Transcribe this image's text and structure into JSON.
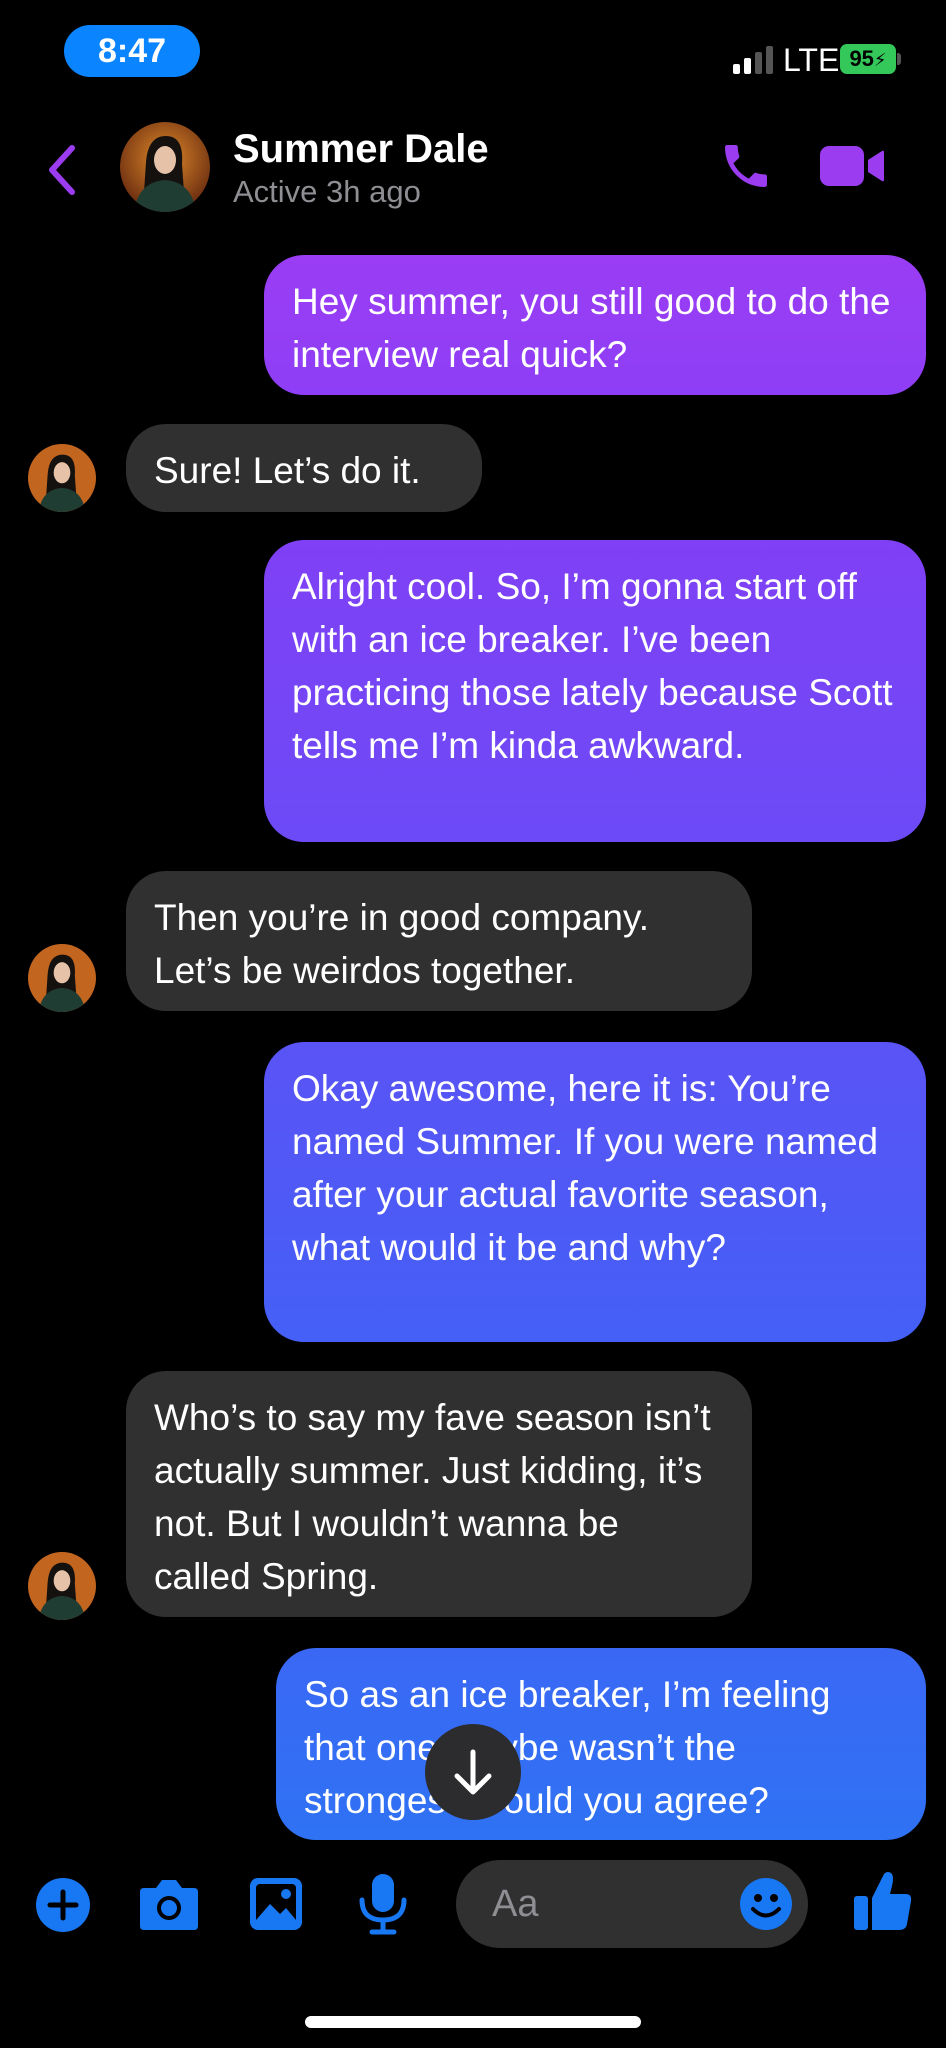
{
  "status_bar": {
    "time": "8:47",
    "network": "LTE",
    "battery": "95"
  },
  "header": {
    "name": "Summer Dale",
    "status": "Active 3h ago"
  },
  "messages": [
    {
      "from": "me",
      "text": "Hey summer, you still good to do the interview real quick?"
    },
    {
      "from": "them",
      "text": "Sure! Let’s do it."
    },
    {
      "from": "me",
      "text": "Alright cool. So, I’m gonna start off with an ice breaker. I’ve been practicing those lately because Scott tells me I’m kinda awkward."
    },
    {
      "from": "them",
      "text": "Then you’re in good company. Let’s be weirdos together."
    },
    {
      "from": "me",
      "text": "Okay awesome, here it is: You’re named Summer. If you were named after your actual favorite season, what would it be and why?"
    },
    {
      "from": "them",
      "text": "Who’s to say my fave season isn’t actually summer. Just kidding, it’s not. But I wouldn’t wanna be called Spring."
    },
    {
      "from": "me",
      "text": "So as an ice breaker, I’m feeling that one maybe wasn’t the strongest, would you agree?"
    }
  ],
  "composer": {
    "placeholder": "Aa"
  },
  "colors": {
    "accent_purple": "#9b3cf0",
    "bubble_purple": "#8e3cf5",
    "bubble_violet": "#6a4cf6",
    "bubble_blue": "#3b66f5",
    "bubble_gray": "#303030",
    "composer_blue": "#1877f2"
  },
  "icons": [
    "back-chevron-icon",
    "phone-icon",
    "video-camera-icon",
    "chevron-down-arrow-icon",
    "plus-icon",
    "camera-icon",
    "image-icon",
    "microphone-icon",
    "emoji-icon",
    "thumbs-up-icon"
  ]
}
